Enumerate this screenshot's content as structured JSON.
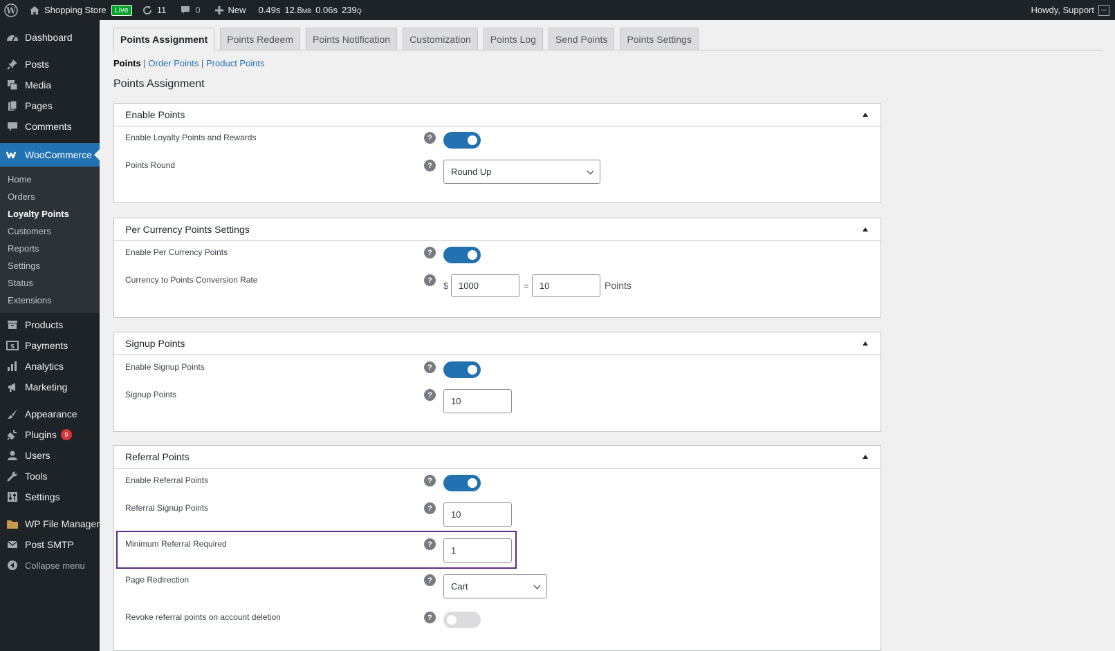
{
  "adminbar": {
    "site_name": "Shopping Store",
    "live_badge": "Live",
    "updates_count": "11",
    "comments_count": "0",
    "new_label": "New",
    "qm_time": "0.49s",
    "qm_memory": "12.8",
    "qm_memory_unit": "MB",
    "qm_db_time": "0.06s",
    "qm_queries": "239",
    "qm_queries_unit": "Q",
    "greeting": "Howdy, Support"
  },
  "sidebar": {
    "dashboard": "Dashboard",
    "posts": "Posts",
    "media": "Media",
    "pages": "Pages",
    "comments": "Comments",
    "woocommerce": "WooCommerce",
    "sub_items": [
      "Home",
      "Orders",
      "Loyalty Points",
      "Customers",
      "Reports",
      "Settings",
      "Status",
      "Extensions"
    ],
    "products": "Products",
    "payments": "Payments",
    "analytics": "Analytics",
    "marketing": "Marketing",
    "appearance": "Appearance",
    "plugins": "Plugins",
    "plugins_badge": "9",
    "users": "Users",
    "tools": "Tools",
    "settings": "Settings",
    "wp_file_manager": "WP File Manager",
    "post_smtp": "Post SMTP",
    "collapse": "Collapse menu"
  },
  "tabs": [
    "Points Assignment",
    "Points Redeem",
    "Points Notification",
    "Customization",
    "Points Log",
    "Send Points",
    "Points Settings"
  ],
  "subnav": {
    "current": "Points",
    "sep": "|",
    "link1": "Order Points",
    "link2": "Product Points"
  },
  "page_title": "Points Assignment",
  "sections": {
    "enable_points": {
      "title": "Enable Points",
      "enable_label": "Enable Loyalty Points and Rewards",
      "enable_value": true,
      "round_label": "Points Round",
      "round_value": "Round Up"
    },
    "per_currency": {
      "title": "Per Currency Points Settings",
      "enable_label": "Enable Per Currency Points",
      "enable_value": true,
      "rate_label": "Currency to Points Conversion Rate",
      "currency_symbol": "$",
      "currency_value": "1000",
      "equals": "=",
      "points_value": "10",
      "points_suffix": "Points"
    },
    "signup": {
      "title": "Signup Points",
      "enable_label": "Enable Signup Points",
      "enable_value": true,
      "points_label": "Signup Points",
      "points_value": "10"
    },
    "referral": {
      "title": "Referral Points",
      "enable_label": "Enable Referral Points",
      "enable_value": true,
      "signup_label": "Referral Signup Points",
      "signup_value": "10",
      "min_label": "Minimum Referral Required",
      "min_value": "1",
      "redirect_label": "Page Redirection",
      "redirect_value": "Cart",
      "revoke_label": "Revoke referral points on account deletion",
      "revoke_value": false
    }
  },
  "help_glyph": "?",
  "colors": {
    "accent": "#2271b1",
    "sidebar_bg": "#1d2327",
    "highlight": "#5b2a86",
    "live": "#00a32a"
  }
}
